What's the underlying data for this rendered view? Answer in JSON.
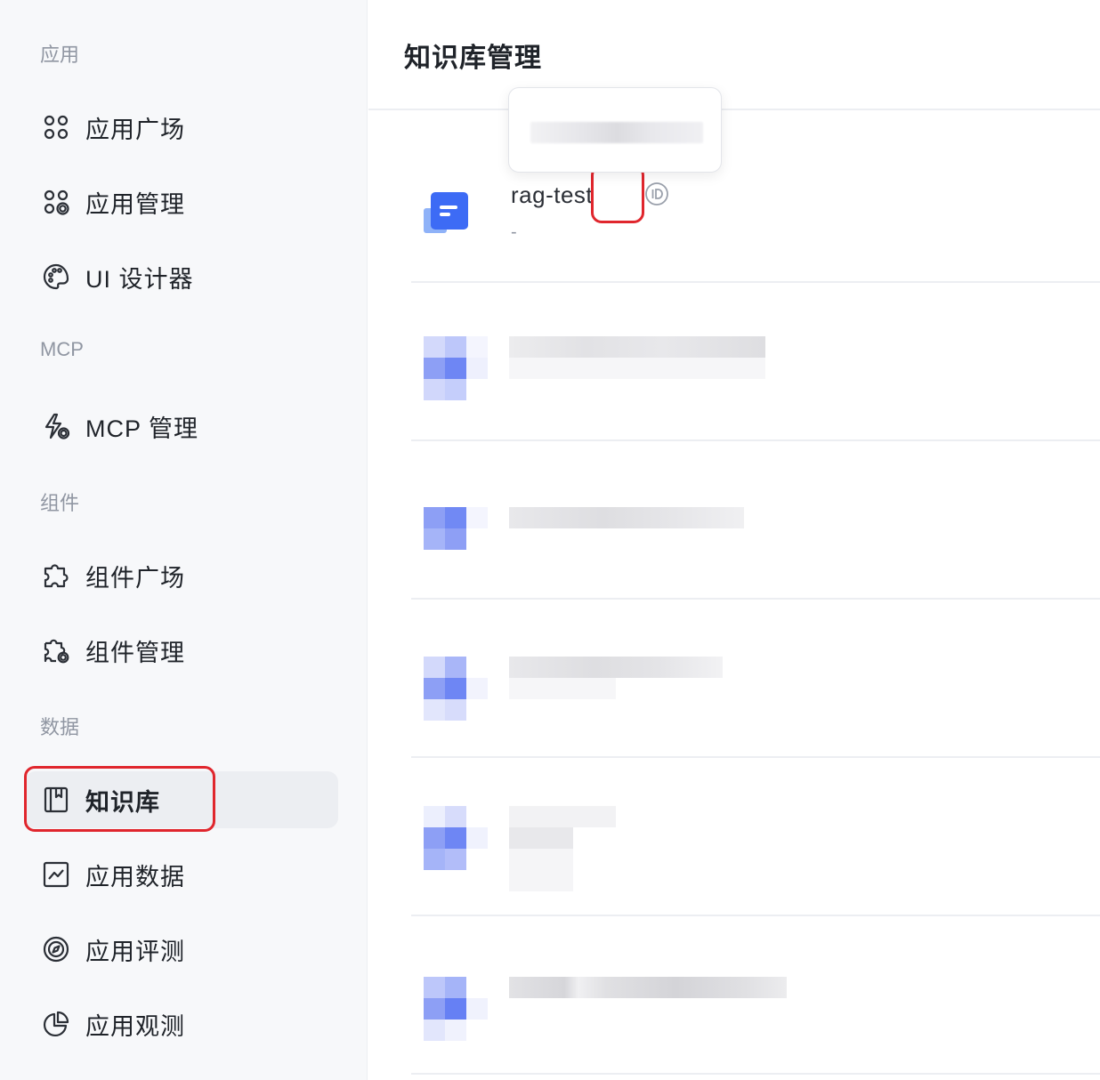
{
  "sidebar": {
    "sections": [
      {
        "title": "应用",
        "items": [
          {
            "label": "应用广场",
            "icon": "apps-grid-icon"
          },
          {
            "label": "应用管理",
            "icon": "apps-settings-icon"
          },
          {
            "label": "UI 设计器",
            "icon": "palette-icon"
          }
        ]
      },
      {
        "title": "MCP",
        "items": [
          {
            "label": "MCP 管理",
            "icon": "mcp-icon"
          }
        ]
      },
      {
        "title": "组件",
        "items": [
          {
            "label": "组件广场",
            "icon": "puzzle-icon"
          },
          {
            "label": "组件管理",
            "icon": "puzzle-settings-icon"
          }
        ]
      },
      {
        "title": "数据",
        "items": [
          {
            "label": "知识库",
            "icon": "book-icon",
            "active": true
          },
          {
            "label": "应用数据",
            "icon": "chart-line-icon"
          },
          {
            "label": "应用评测",
            "icon": "compass-icon"
          },
          {
            "label": "应用观测",
            "icon": "pie-chart-icon"
          }
        ]
      }
    ]
  },
  "main": {
    "title": "知识库管理",
    "knowledge_bases": [
      {
        "name": "rag-test",
        "description": "-"
      }
    ]
  },
  "colors": {
    "accent": "#3d6bf5",
    "highlight": "#e0262d",
    "sidebar_bg": "#f7f8fa"
  }
}
